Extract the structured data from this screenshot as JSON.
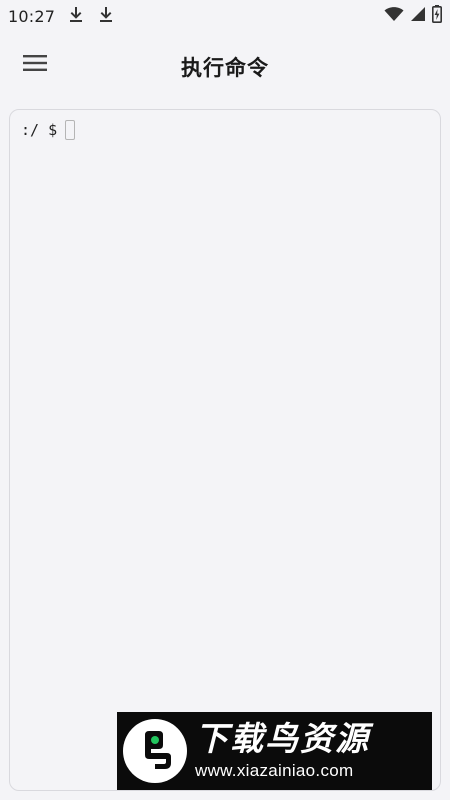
{
  "status_bar": {
    "time": "10:27",
    "left_icons": [
      "download-icon",
      "download-icon"
    ],
    "right_icons": [
      "wifi-icon",
      "signal-icon",
      "battery-icon"
    ]
  },
  "app_bar": {
    "menu_icon": "menu-icon",
    "title": "执行命令"
  },
  "terminal": {
    "prompt": ":/ $",
    "input_value": ""
  },
  "watermark": {
    "title": "下载鸟资源",
    "url": "www.xiazainiao.com",
    "logo_accent_color": "#22c55e"
  },
  "colors": {
    "background": "#f4f4f7",
    "panel_border": "#d9d9de",
    "watermark_bg": "#0b0b0b"
  }
}
